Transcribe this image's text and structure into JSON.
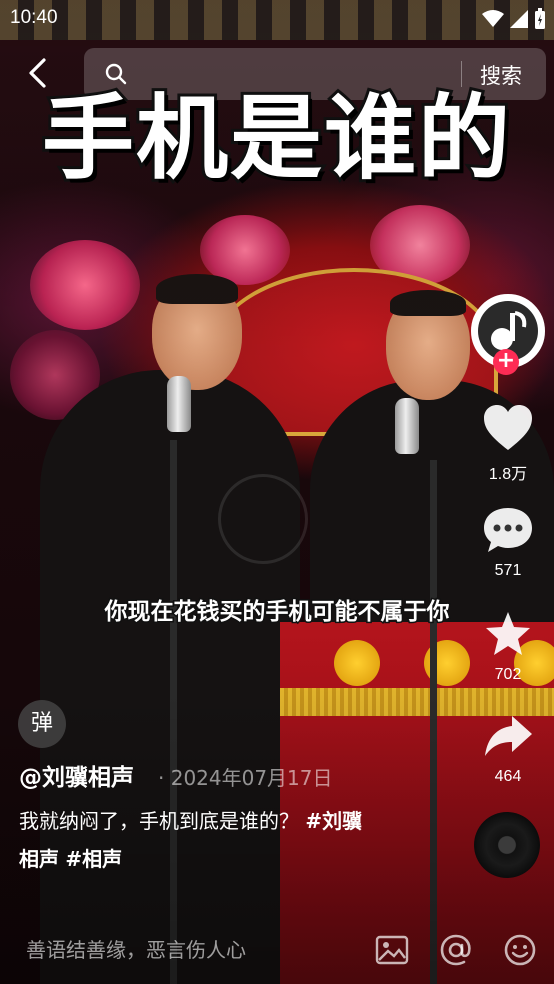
{
  "status_bar": {
    "time": "10:40"
  },
  "search": {
    "button_label": "搜索"
  },
  "video": {
    "headline": "手机是谁的",
    "subtitle": "你现在花钱买的手机可能不属于你"
  },
  "rail": {
    "likes": "1.8万",
    "comments": "571",
    "favorites": "702",
    "shares": "464"
  },
  "danmaku": {
    "label": "弹"
  },
  "caption": {
    "author": "@刘骥相声",
    "date": "· 2024年07月17日",
    "text": "我就纳闷了，手机到底是谁的？",
    "tag1": "#刘骥",
    "tag1_cont": "相声",
    "tag2": "#相声"
  },
  "comment_bar": {
    "placeholder": "善语结善缘，恶言伤人心"
  },
  "colors": {
    "accent": "#fe2c55",
    "gold": "#e4a612",
    "curtain_red": "#b4141c"
  },
  "icons": [
    "back-icon",
    "search-icon",
    "heart-icon",
    "comment-icon",
    "star-icon",
    "share-icon",
    "image-icon",
    "at-icon",
    "emoji-icon",
    "music-disc-icon",
    "plus-icon"
  ]
}
